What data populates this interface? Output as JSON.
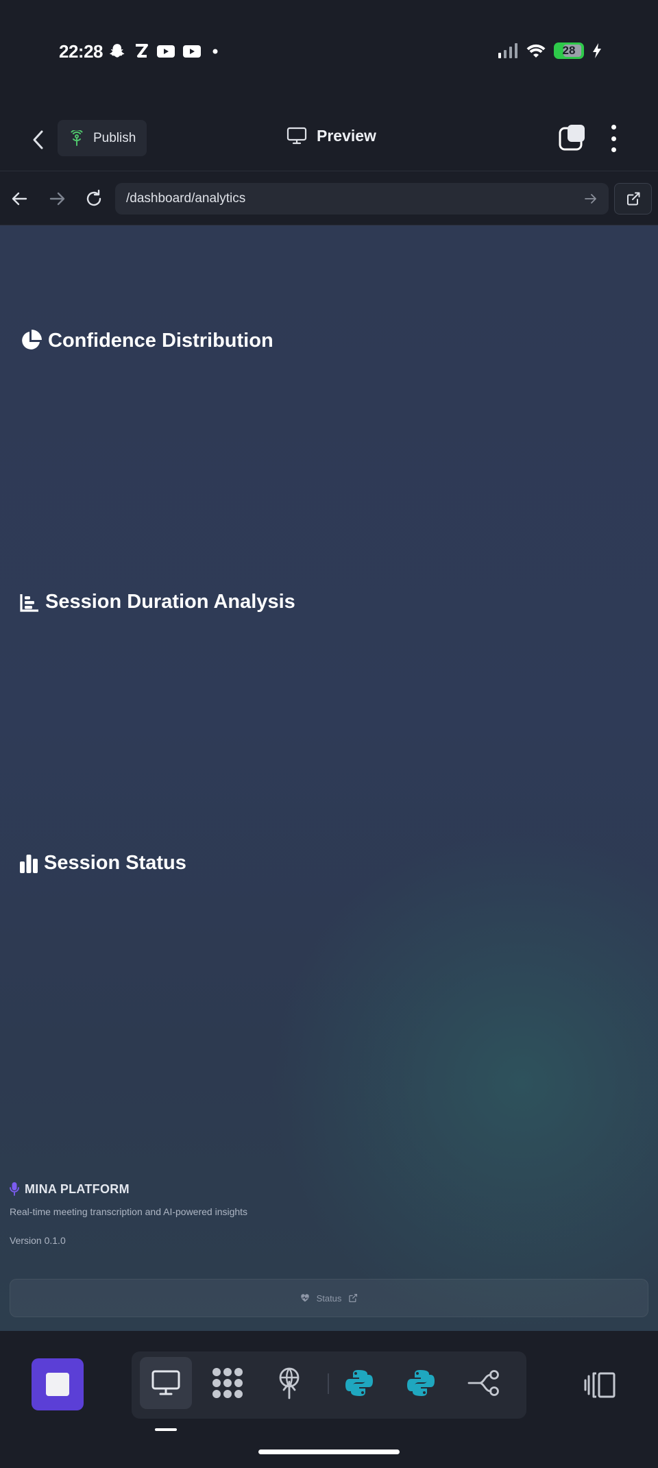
{
  "status_bar": {
    "time": "22:28",
    "battery": "28",
    "left_icons": [
      "snapchat-icon",
      "z-app-icon",
      "youtube-icon",
      "youtube-icon",
      "dot-icon"
    ],
    "right_icons": [
      "signal-icon",
      "wifi-icon",
      "battery-icon",
      "charging-icon"
    ]
  },
  "header": {
    "publish_label": "Publish",
    "preview_label": "Preview",
    "publish_icon": "antenna-icon",
    "preview_icon": "monitor-icon"
  },
  "browser": {
    "url": "/dashboard/analytics"
  },
  "sections": [
    {
      "title": "Confidence Distribution",
      "icon": "pie-chart-icon"
    },
    {
      "title": "Session Duration Analysis",
      "icon": "bar-chart-horizontal-icon"
    },
    {
      "title": "Session Status",
      "icon": "bar-chart-icon"
    }
  ],
  "footer": {
    "brand": "MINA PLATFORM",
    "tagline": "Real-time meeting transcription and AI-powered insights",
    "version": "Version 0.1.0",
    "status_label": "Status"
  },
  "toolbar": {
    "tools": [
      "monitor-icon",
      "dots-grid-icon",
      "antenna-icon",
      "python-icon",
      "python-icon",
      "git-branch-icon"
    ],
    "active_tool": "monitor-icon"
  },
  "colors": {
    "accent": "#5b3fd6",
    "publish_icon": "#4fc36b",
    "battery": "#2ec94a",
    "python": "#1fa7bf"
  }
}
